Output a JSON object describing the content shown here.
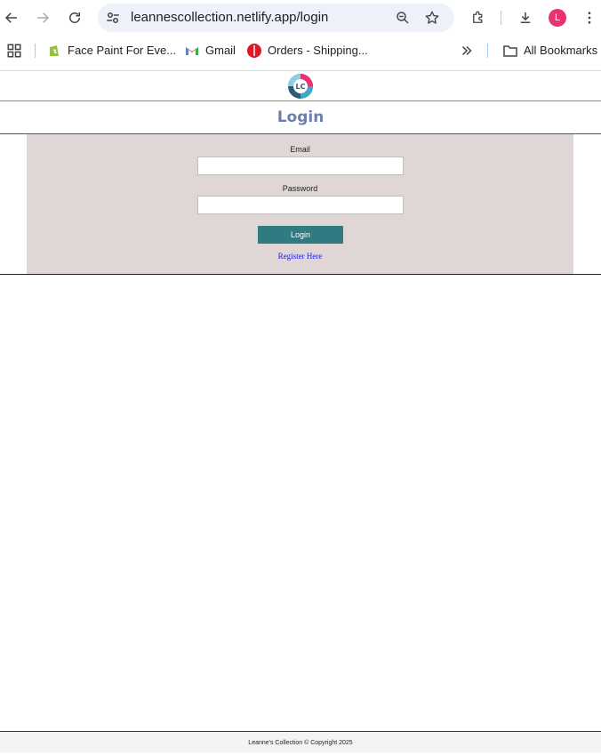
{
  "browser": {
    "url": "leannescollection.netlify.app/login",
    "profile_initial": "L",
    "bookmarks": [
      {
        "label": "Face Paint For Eve...",
        "icon": "shopify-icon"
      },
      {
        "label": "Gmail",
        "icon": "gmail-icon"
      },
      {
        "label": "Orders - Shipping...",
        "icon": "orders-icon"
      }
    ],
    "all_bookmarks_label": "All Bookmarks",
    "colors": {
      "omnibox": "#edf2fa",
      "avatar": "#e8336f"
    }
  },
  "page": {
    "logo_text": "LC",
    "title": "Login",
    "form": {
      "email_label": "Email",
      "email_value": "",
      "password_label": "Password",
      "password_value": "",
      "submit_label": "Login",
      "register_link": "Register Here"
    },
    "footer": "Leanne's Collection © Copyright 2025",
    "colors": {
      "title": "#6e7fae",
      "panel": "#e0d6d6",
      "button": "#2f7b82",
      "link": "#1a1ae0"
    }
  }
}
